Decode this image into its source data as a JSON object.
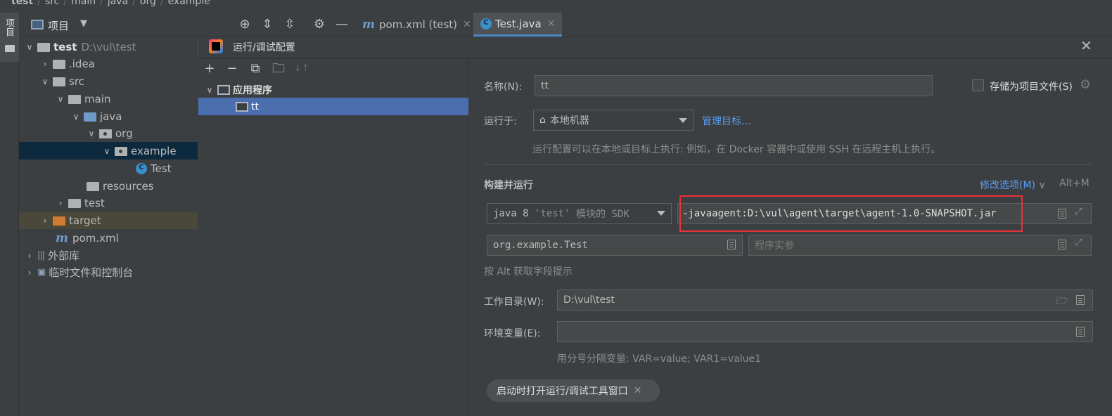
{
  "breadcrumb": [
    "test",
    "src",
    "main",
    "java",
    "org",
    "example"
  ],
  "left_strip": {
    "tab_label": "项目"
  },
  "project_panel": {
    "title": "项目",
    "tree": [
      {
        "label": "test",
        "extra": "D:\\vul\\test"
      },
      {
        "label": ".idea"
      },
      {
        "label": "src"
      },
      {
        "label": "main"
      },
      {
        "label": "java"
      },
      {
        "label": "org"
      },
      {
        "label": "example"
      },
      {
        "label": "Test"
      },
      {
        "label": "resources"
      },
      {
        "label": "test"
      },
      {
        "label": "target"
      },
      {
        "label": "pom.xml"
      },
      {
        "label": "外部库"
      },
      {
        "label": "临时文件和控制台"
      }
    ]
  },
  "editor_tabs": [
    {
      "label": "pom.xml (test)"
    },
    {
      "label": "Test.java"
    }
  ],
  "dialog": {
    "title": "运行/调试配置",
    "tree_group": "应用程序",
    "tree_item": "tt",
    "name_label": "名称(N):",
    "name_value": "tt",
    "store_label": "存储为项目文件(S)",
    "run_on_label": "运行于:",
    "run_on_value": "本地机器",
    "manage_targets": "管理目标...",
    "run_on_hint": "运行配置可以在本地或目标上执行: 例如，在 Docker 容器中或使用 SSH 在远程主机上执行。",
    "section_title": "构建并运行",
    "modify_options": "修改选项(M)",
    "modify_shortcut": "Alt+M",
    "sdk_prefix": "java 8",
    "sdk_module": "'test'",
    "sdk_suffix": "模块的 SDK",
    "vm_options": "-javaagent:D:\\vul\\agent\\target\\agent-1.0-SNAPSHOT.jar",
    "main_class": "org.example.Test",
    "program_args_placeholder": "程序实参",
    "alt_hint": "按 Alt 获取字段提示",
    "workdir_label": "工作目录(W):",
    "workdir_value": "D:\\vul\\test",
    "env_label": "环境变量(E):",
    "env_value": "",
    "env_hint": "用分号分隔变量: VAR=value; VAR1=value1",
    "chip_label": "启动时打开运行/调试工具窗口"
  },
  "colors": {
    "accent_blue": "#4b6eaf",
    "link": "#589df6",
    "highlight_red": "#e8333a",
    "background": "#3c3f41"
  }
}
